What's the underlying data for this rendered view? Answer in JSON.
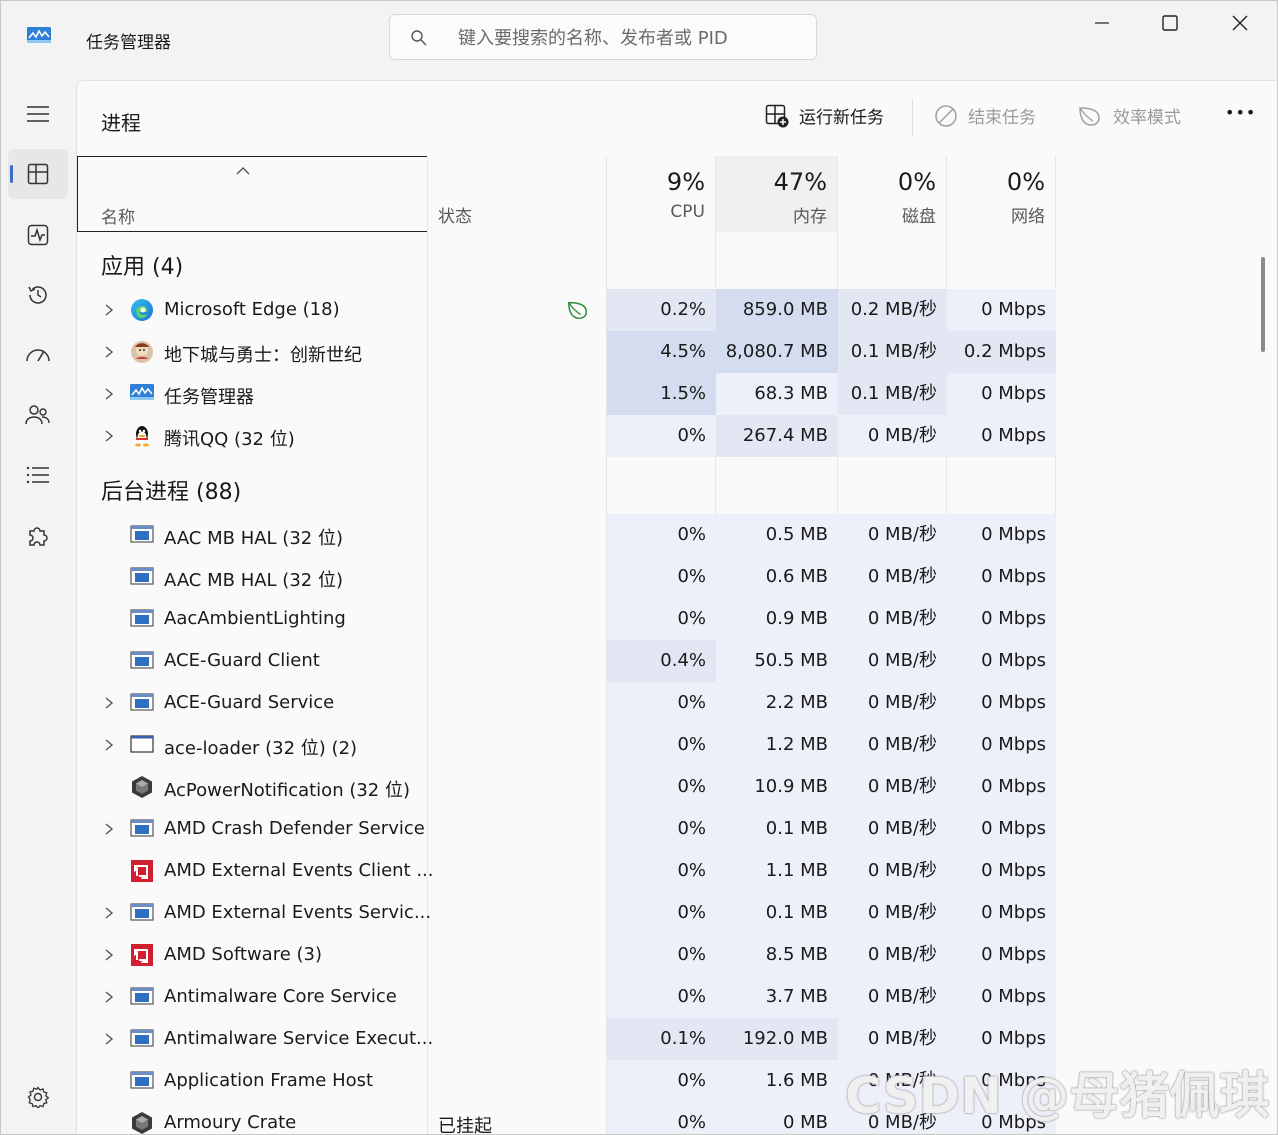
{
  "titlebar": {
    "app_title": "任务管理器",
    "search_placeholder": "键入要搜索的名称、发布者或 PID"
  },
  "nav": {
    "items": [
      "menu",
      "processes",
      "performance",
      "app-history",
      "startup-apps",
      "users",
      "details",
      "services"
    ],
    "active": "processes",
    "settings": "settings"
  },
  "page": {
    "title": "进程",
    "run_new_task": "运行新任务",
    "end_task": "结束任务",
    "efficiency_mode": "效率模式",
    "more": "•••"
  },
  "columns": {
    "name": "名称",
    "status": "状态",
    "cpu_pct": "9%",
    "cpu": "CPU",
    "mem_pct": "47%",
    "mem": "内存",
    "disk_pct": "0%",
    "disk": "磁盘",
    "net_pct": "0%",
    "net": "网络"
  },
  "sections": {
    "apps": "应用 (4)",
    "background": "后台进程 (88)"
  },
  "apps": [
    {
      "name": "Microsoft Edge (18)",
      "status": "",
      "cpu": "0.2%",
      "mem": "859.0 MB",
      "disk": "0.2 MB/秒",
      "net": "0 Mbps",
      "icon": "edge-icon",
      "expandable": true,
      "efficiency": true
    },
    {
      "name": "地下城与勇士：创新世纪",
      "status": "",
      "cpu": "4.5%",
      "mem": "8,080.7 MB",
      "disk": "0.1 MB/秒",
      "net": "0.2 Mbps",
      "icon": "game-icon",
      "expandable": true,
      "efficiency": false
    },
    {
      "name": "任务管理器",
      "status": "",
      "cpu": "1.5%",
      "mem": "68.3 MB",
      "disk": "0.1 MB/秒",
      "net": "0 Mbps",
      "icon": "taskmgr-icon",
      "expandable": true,
      "efficiency": false
    },
    {
      "name": "腾讯QQ (32 位)",
      "status": "",
      "cpu": "0%",
      "mem": "267.4 MB",
      "disk": "0 MB/秒",
      "net": "0 Mbps",
      "icon": "qq-icon",
      "expandable": true,
      "efficiency": false
    }
  ],
  "background": [
    {
      "name": "AAC MB HAL (32 位)",
      "status": "",
      "cpu": "0%",
      "mem": "0.5 MB",
      "disk": "0 MB/秒",
      "net": "0 Mbps",
      "icon": "window-app-icon",
      "expandable": false
    },
    {
      "name": "AAC MB HAL (32 位)",
      "status": "",
      "cpu": "0%",
      "mem": "0.6 MB",
      "disk": "0 MB/秒",
      "net": "0 Mbps",
      "icon": "window-app-icon",
      "expandable": false
    },
    {
      "name": "AacAmbientLighting",
      "status": "",
      "cpu": "0%",
      "mem": "0.9 MB",
      "disk": "0 MB/秒",
      "net": "0 Mbps",
      "icon": "window-app-icon",
      "expandable": false
    },
    {
      "name": "ACE-Guard Client",
      "status": "",
      "cpu": "0.4%",
      "mem": "50.5 MB",
      "disk": "0 MB/秒",
      "net": "0 Mbps",
      "icon": "window-app-icon",
      "expandable": false
    },
    {
      "name": "ACE-Guard Service",
      "status": "",
      "cpu": "0%",
      "mem": "2.2 MB",
      "disk": "0 MB/秒",
      "net": "0 Mbps",
      "icon": "window-app-icon",
      "expandable": true
    },
    {
      "name": "ace-loader (32 位) (2)",
      "status": "",
      "cpu": "0%",
      "mem": "1.2 MB",
      "disk": "0 MB/秒",
      "net": "0 Mbps",
      "icon": "blank-window-icon",
      "expandable": true
    },
    {
      "name": "AcPowerNotification (32 位)",
      "status": "",
      "cpu": "0%",
      "mem": "10.9 MB",
      "disk": "0 MB/秒",
      "net": "0 Mbps",
      "icon": "hexagon-app-icon",
      "expandable": false
    },
    {
      "name": "AMD Crash Defender Service",
      "status": "",
      "cpu": "0%",
      "mem": "0.1 MB",
      "disk": "0 MB/秒",
      "net": "0 Mbps",
      "icon": "window-app-icon",
      "expandable": true
    },
    {
      "name": "AMD External Events Client ...",
      "status": "",
      "cpu": "0%",
      "mem": "1.1 MB",
      "disk": "0 MB/秒",
      "net": "0 Mbps",
      "icon": "amd-icon",
      "expandable": false
    },
    {
      "name": "AMD External Events Servic...",
      "status": "",
      "cpu": "0%",
      "mem": "0.1 MB",
      "disk": "0 MB/秒",
      "net": "0 Mbps",
      "icon": "window-app-icon",
      "expandable": true
    },
    {
      "name": "AMD Software (3)",
      "status": "",
      "cpu": "0%",
      "mem": "8.5 MB",
      "disk": "0 MB/秒",
      "net": "0 Mbps",
      "icon": "amd-icon",
      "expandable": true
    },
    {
      "name": "Antimalware Core Service",
      "status": "",
      "cpu": "0%",
      "mem": "3.7 MB",
      "disk": "0 MB/秒",
      "net": "0 Mbps",
      "icon": "window-app-icon",
      "expandable": true
    },
    {
      "name": "Antimalware Service Execut...",
      "status": "",
      "cpu": "0.1%",
      "mem": "192.0 MB",
      "disk": "0 MB/秒",
      "net": "0 Mbps",
      "icon": "window-app-icon",
      "expandable": true
    },
    {
      "name": "Application Frame Host",
      "status": "",
      "cpu": "0%",
      "mem": "1.6 MB",
      "disk": "0 MB/秒",
      "net": "0 Mbps",
      "icon": "window-app-icon",
      "expandable": false
    },
    {
      "name": "Armoury Crate",
      "status": "已挂起",
      "cpu": "0%",
      "mem": "0 MB",
      "disk": "0 MB/秒",
      "net": "0 Mbps",
      "icon": "hexagon-app-icon",
      "expandable": false
    }
  ],
  "colors": {
    "heat_low": "#eef0f9",
    "heat_mid": "#e3e7f3",
    "heat_high": "#d3ddef",
    "accent": "#3b6cc6"
  },
  "watermark": "CSDN @母猪佩琪"
}
